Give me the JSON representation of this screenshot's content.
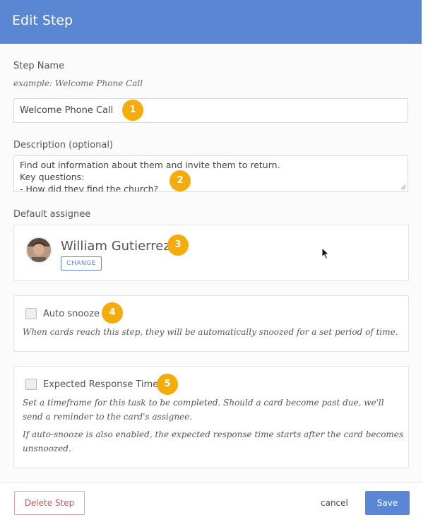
{
  "header": {
    "title": "Edit Step"
  },
  "step_name": {
    "label": "Step Name",
    "hint": "example: Welcome Phone Call",
    "value": "Welcome Phone Call"
  },
  "description": {
    "label": "Description (optional)",
    "lines": [
      "Find out information about them and invite them to return.",
      "Key questions:",
      "- How did they find the church?"
    ]
  },
  "assignee": {
    "label": "Default assignee",
    "name": "William Gutierrez",
    "change_label": "CHANGE"
  },
  "auto_snooze": {
    "label": "Auto snooze",
    "checked": false,
    "note": "When cards reach this step, they will be automatically snoozed for a set period of time."
  },
  "expected_response": {
    "label": "Expected Response Time",
    "checked": false,
    "note1": "Set a timeframe for this task to be completed. Should a card become past due, we'll send a reminder to the card's assignee.",
    "note2": "If auto-snooze is also enabled, the expected response time starts after the card becomes unsnoozed."
  },
  "badges": [
    "1",
    "2",
    "3",
    "4",
    "5"
  ],
  "footer": {
    "delete_label": "Delete Step",
    "cancel_label": "cancel",
    "save_label": "Save"
  },
  "colors": {
    "accent": "#5b86d4",
    "badge": "#f5ab0a",
    "danger": "#d9534f"
  }
}
